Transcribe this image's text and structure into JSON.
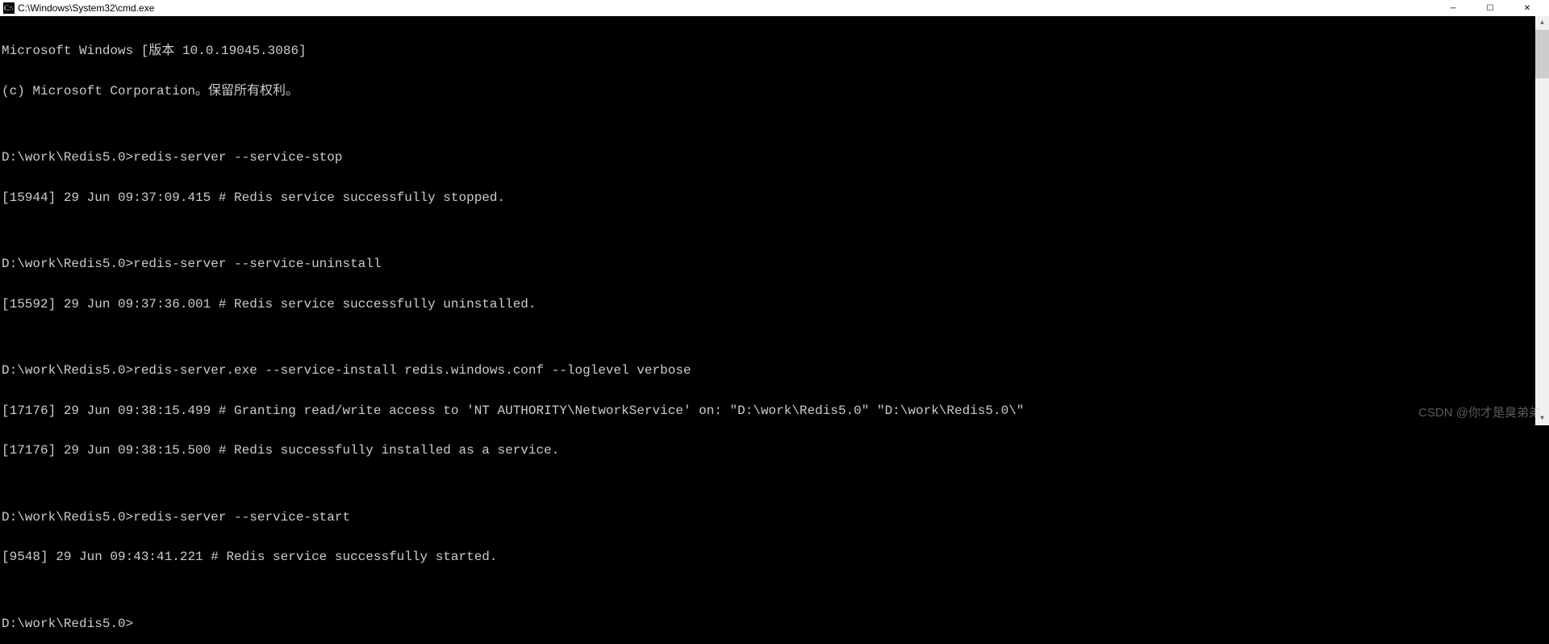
{
  "titlebar": {
    "title": "C:\\Windows\\System32\\cmd.exe",
    "minimize": "─",
    "maximize": "☐",
    "close": "✕"
  },
  "terminal": {
    "lines": [
      "Microsoft Windows [版本 10.0.19045.3086]",
      "(c) Microsoft Corporation。保留所有权利。",
      "",
      "D:\\work\\Redis5.0>redis-server --service-stop",
      "[15944] 29 Jun 09:37:09.415 # Redis service successfully stopped.",
      "",
      "D:\\work\\Redis5.0>redis-server --service-uninstall",
      "[15592] 29 Jun 09:37:36.001 # Redis service successfully uninstalled.",
      "",
      "D:\\work\\Redis5.0>redis-server.exe --service-install redis.windows.conf --loglevel verbose",
      "[17176] 29 Jun 09:38:15.499 # Granting read/write access to 'NT AUTHORITY\\NetworkService' on: \"D:\\work\\Redis5.0\" \"D:\\work\\Redis5.0\\\"",
      "[17176] 29 Jun 09:38:15.500 # Redis successfully installed as a service.",
      "",
      "D:\\work\\Redis5.0>redis-server --service-start",
      "[9548] 29 Jun 09:43:41.221 # Redis service successfully started.",
      "",
      "D:\\work\\Redis5.0>"
    ]
  },
  "watermark": "CSDN @你才是臭弟弟"
}
